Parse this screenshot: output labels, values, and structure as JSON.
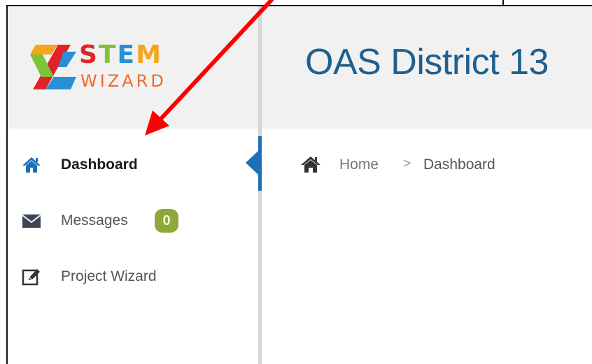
{
  "brand": {
    "logo_word1": [
      "S",
      "T",
      "E",
      "M"
    ],
    "logo_word2": "WIZARD"
  },
  "header": {
    "title": "OAS District 13"
  },
  "sidebar": {
    "items": [
      {
        "label": "Dashboard",
        "icon": "home-icon",
        "active": true
      },
      {
        "label": "Messages",
        "icon": "envelope-icon",
        "badge": "0"
      },
      {
        "label": "Project Wizard",
        "icon": "edit-icon"
      }
    ]
  },
  "breadcrumb": {
    "home": "Home",
    "separator": ">",
    "current": "Dashboard"
  },
  "colors": {
    "accent": "#1f6fb5",
    "title": "#1f5f8f",
    "badge": "#8fa83a",
    "annotation": "#ff0000"
  }
}
